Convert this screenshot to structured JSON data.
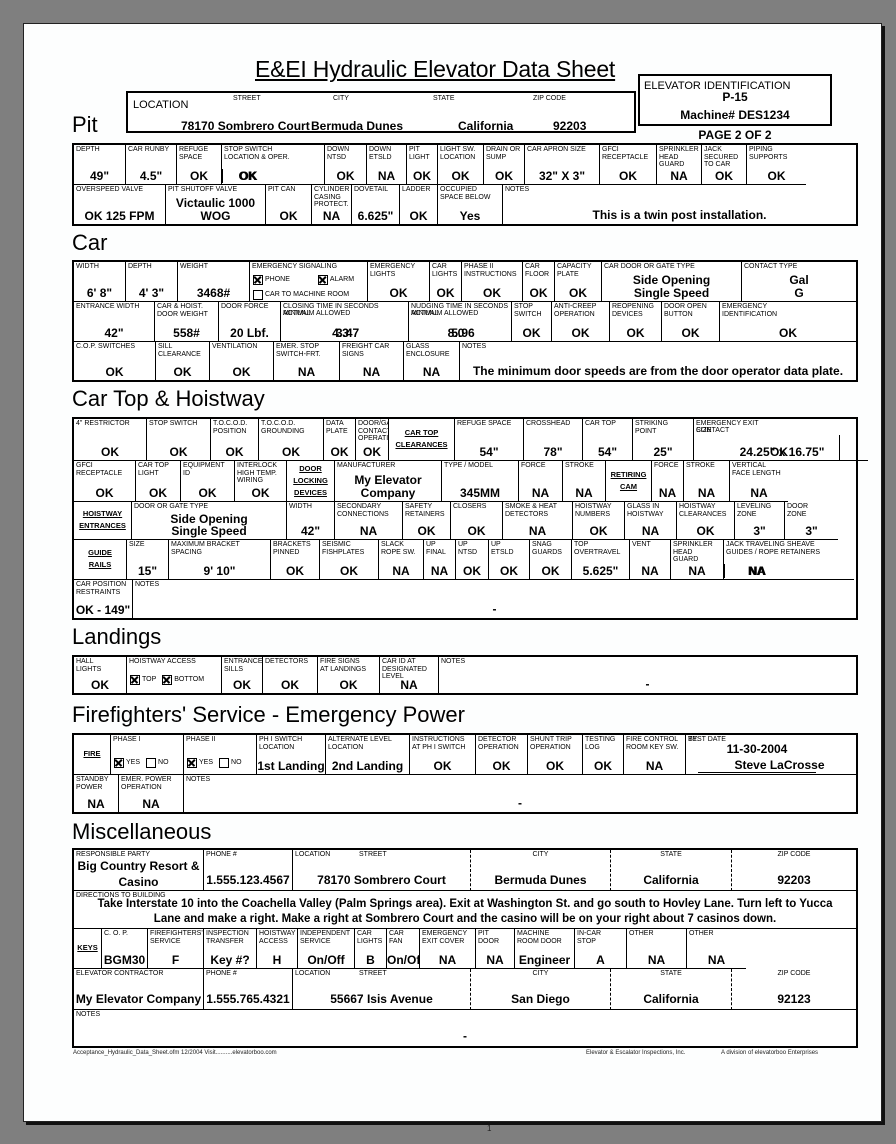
{
  "document": {
    "title": "E&EI Hydraulic Elevator Data Sheet",
    "page_label": "PAGE 2 OF 2",
    "page_number": "1"
  },
  "header": {
    "location_label": "LOCATION",
    "street_label": "STREET",
    "city_label": "CITY",
    "state_label": "STATE",
    "zip_label": "ZIP CODE",
    "street": "78170 Sombrero Court",
    "city": "Bermuda Dunes",
    "state": "California",
    "zip": "92203",
    "elev_id_label": "ELEVATOR IDENTIFICATION",
    "elev_id": "P-15",
    "machine": "Machine# DES1234"
  },
  "sections": {
    "pit": "Pit",
    "car": "Car",
    "cartop": "Car Top & Hoistway",
    "landings": "Landings",
    "fire": "Firefighters' Service - Emergency Power",
    "misc": "Miscellaneous"
  },
  "pit": {
    "row1": [
      {
        "label": "DEPTH",
        "value": "49\""
      },
      {
        "label": "CAR RUNBY",
        "value": "4.5\""
      },
      {
        "label": "REFUGE\nSPACE",
        "value": "OK"
      },
      {
        "label": "STOP SWITCH\nLOCATION & OPER.",
        "value": "OK",
        "value2": "OK"
      },
      {
        "label": "DOWN\nNTSD",
        "value": "OK"
      },
      {
        "label": "DOWN\nETSLD",
        "value": "NA"
      },
      {
        "label": "PIT\nLIGHT",
        "value": "OK"
      },
      {
        "label": "LIGHT SW.\nLOCATION",
        "value": "OK"
      },
      {
        "label": "DRAIN OR\nSUMP",
        "value": "OK"
      },
      {
        "label": "CAR APRON SIZE",
        "value": "32\" X 3\""
      },
      {
        "label": "GFCI\nRECEPTACLE",
        "value": "OK"
      },
      {
        "label": "SPRINKLER\nHEAD\nGUARD",
        "value": "NA"
      },
      {
        "label": "JACK\nSECURED\nTO CAR",
        "value": "OK"
      },
      {
        "label": "PIPING\nSUPPORTS",
        "value": "OK"
      }
    ],
    "row2": [
      {
        "label": "OVERSPEED VALVE",
        "value": "OK 125 FPM"
      },
      {
        "label": "PIT SHUTOFF VALVE",
        "value": "Victaulic 1000",
        "value2": "WOG"
      },
      {
        "label": "PIT CAN",
        "value": "OK"
      },
      {
        "label": "CYLINDER\nCASING\nPROTECT.",
        "value": "NA"
      },
      {
        "label": "DOVETAIL",
        "value": "6.625\""
      },
      {
        "label": "LADDER",
        "value": "OK"
      },
      {
        "label": "OCCUPIED\nSPACE BELOW",
        "value": "Yes"
      },
      {
        "label": "NOTES",
        "value": "This is a twin post installation."
      }
    ]
  },
  "car": {
    "row1": [
      {
        "label": "WIDTH",
        "value": "6' 8\""
      },
      {
        "label": "DEPTH",
        "value": "4' 3\""
      },
      {
        "label": "WEIGHT",
        "value": "3468#"
      },
      {
        "label": "EMERGENCY SIGNALING",
        "phone": "PHONE",
        "alarm": "ALARM",
        "car_to_machine": "CAR TO MACHINE ROOM"
      },
      {
        "label": "EMERGENCY\nLIGHTS",
        "value": "OK"
      },
      {
        "label": "CAR\nLIGHTS",
        "value": "OK"
      },
      {
        "label": "PHASE II\nINSTRUCTIONS",
        "value": "OK"
      },
      {
        "label": "CAR\nFLOOR",
        "value": "OK"
      },
      {
        "label": "CAPACITY\nPLATE",
        "value": "OK"
      },
      {
        "label": "CAR DOOR OR GATE TYPE",
        "value": "Side Opening",
        "value2": "Single Speed"
      },
      {
        "label": "CONTACT TYPE",
        "value": "Gal",
        "value2": "G"
      }
    ],
    "signaling": {
      "phone": true,
      "alarm": true,
      "car_to_machine": false
    },
    "row2": [
      {
        "label": "ENTRANCE WIDTH",
        "value": "42\""
      },
      {
        "label": "CAR & HOIST.\nDOOR WEIGHT",
        "value": "558#"
      },
      {
        "label": "DOOR FORCE",
        "value": "20 Lbf."
      },
      {
        "label": "CLOSING TIME IN SECONDS",
        "sub1": "MINIMUM ALLOWED",
        "sub2": "ACTUAL",
        "value": "3.47",
        "value2": "4.3"
      },
      {
        "label": "NUDGING TIME IN SECONDS",
        "sub1": "MINIMUM ALLOWED",
        "sub2": "ACTUAL",
        "value": "5.96",
        "value2": "8.0"
      },
      {
        "label": "STOP\nSWITCH",
        "value": "OK"
      },
      {
        "label": "ANTI-CREEP\nOPERATION",
        "value": "OK"
      },
      {
        "label": "REOPENING\nDEVICES",
        "value": "OK"
      },
      {
        "label": "DOOR OPEN\nBUTTON",
        "value": "OK"
      },
      {
        "label": "EMERGENCY\nIDENTIFICATION",
        "value": "OK"
      }
    ],
    "row3": [
      {
        "label": "C.O.P. SWITCHES",
        "value": "OK"
      },
      {
        "label": "SILL\nCLEARANCE",
        "value": "OK"
      },
      {
        "label": "VENTILATION",
        "value": "OK"
      },
      {
        "label": "EMER. STOP\nSWITCH-FRT.",
        "value": "NA"
      },
      {
        "label": "FREIGHT CAR\nSIGNS",
        "value": "NA"
      },
      {
        "label": "GLASS\nENCLOSURE",
        "value": "NA"
      },
      {
        "label": "NOTES",
        "value": "The minimum door speeds are from the door operator data plate."
      }
    ]
  },
  "cartop": {
    "row1": [
      {
        "label": "4\" RESTRICTOR",
        "value": "OK"
      },
      {
        "label": "STOP SWITCH",
        "value": "OK"
      },
      {
        "label": "T.O.C.O.D.\nPOSITION",
        "value": "OK"
      },
      {
        "label": "T.O.C.O.D.\nGROUNDING",
        "value": "OK"
      },
      {
        "label": "DATA\nPLATE",
        "value": "OK"
      },
      {
        "label": "DOOR/GATE\nCONTACT\nOPERATION",
        "value": "OK"
      },
      {
        "heading": "CAR TOP",
        "heading2": "CLEARANCES"
      },
      {
        "label": "REFUGE SPACE",
        "value": "54\""
      },
      {
        "label": "CROSSHEAD",
        "value": "78\""
      },
      {
        "label": "CAR TOP",
        "value": "54\""
      },
      {
        "label": "STRIKING\nPOINT",
        "value": "25\""
      },
      {
        "label": "EMERGENCY EXIT",
        "sub1": "SIZE",
        "sub2": "CONTACT",
        "value": "24.25\" x 16.75\"",
        "value2": "OK"
      }
    ],
    "row2": [
      {
        "label": "GFCI\nRECEPTACLE",
        "value": "OK"
      },
      {
        "label": "CAR TOP\nLIGHT",
        "value": "OK"
      },
      {
        "label": "EQUIPMENT\nID",
        "value": "OK"
      },
      {
        "label": "INTERLOCK\nHIGH TEMP.\nWIRING",
        "value": "OK"
      },
      {
        "heading": "DOOR",
        "heading2": "LOCKING",
        "heading3": "DEVICES"
      },
      {
        "label": "MANUFACTURER",
        "value": "My Elevator",
        "value2": "Company"
      },
      {
        "label": "TYPE / MODEL",
        "value": "345MM"
      },
      {
        "label": "FORCE",
        "value": "NA"
      },
      {
        "label": "STROKE",
        "value": "NA"
      },
      {
        "heading": "RETIRING",
        "heading2": "CAM"
      },
      {
        "label": "FORCE",
        "value": "NA"
      },
      {
        "label": "STROKE",
        "value": "NA"
      },
      {
        "label": "VERTICAL\nFACE LENGTH",
        "value": "NA"
      }
    ],
    "row3": [
      {
        "heading": "HOISTWAY",
        "heading2": "ENTRANCES"
      },
      {
        "label": "DOOR OR GATE TYPE",
        "value": "Side Opening",
        "value2": "Single Speed"
      },
      {
        "label": "WIDTH",
        "value": "42\""
      },
      {
        "label": "SECONDARY\nCONNECTIONS",
        "value": "NA"
      },
      {
        "label": "SAFETY\nRETAINERS",
        "value": "OK"
      },
      {
        "label": "CLOSERS",
        "value": "OK"
      },
      {
        "label": "SMOKE & HEAT\nDETECTORS",
        "value": "NA"
      },
      {
        "label": "HOISTWAY\nNUMBERS",
        "value": "OK"
      },
      {
        "label": "GLASS IN\nHOISTWAY",
        "value": "NA"
      },
      {
        "label": "HOISTWAY\nCLEARANCES",
        "value": "OK"
      },
      {
        "label": "LEVELING\nZONE",
        "value": "3\""
      },
      {
        "label": "DOOR\nZONE",
        "value": "3\""
      }
    ],
    "row4": [
      {
        "heading": "GUIDE",
        "heading2": "RAILS"
      },
      {
        "label": "SIZE",
        "value": "15\""
      },
      {
        "label": "MAXIMUM BRACKET\nSPACING",
        "value": "9' 10\""
      },
      {
        "label": "BRACKETS\nPINNED",
        "value": "OK"
      },
      {
        "label": "SEISMIC\nFISHPLATES",
        "value": "OK"
      },
      {
        "label": "SLACK\nROPE SW.",
        "value": "NA"
      },
      {
        "label": "UP\nFINAL",
        "value": "NA"
      },
      {
        "label": "UP\nNTSD",
        "value": "OK"
      },
      {
        "label": "UP\nETSLD",
        "value": "OK"
      },
      {
        "label": "SNAG\nGUARDS",
        "value": "OK"
      },
      {
        "label": "TOP\nOVERTRAVEL",
        "value": "5.625\""
      },
      {
        "label": "VENT",
        "value": "NA"
      },
      {
        "label": "SPRINKLER\nHEAD\nGUARD",
        "value": "NA"
      },
      {
        "label": "JACK TRAVELING SHEAVE\nGUIDES / ROPE RETAINERS",
        "value": "NA",
        "value2": "NA"
      }
    ],
    "row5": [
      {
        "label": "CAR POSITION\nRESTRAINTS",
        "value": "OK - 149\""
      },
      {
        "label": "NOTES",
        "value": "-"
      }
    ]
  },
  "landings": {
    "row1": [
      {
        "label": "HALL\nLIGHTS",
        "value": "OK"
      },
      {
        "label": "HOISTWAY ACCESS",
        "top": "TOP",
        "bottom": "BOTTOM"
      },
      {
        "label": "ENTRANCE\nSILLS",
        "value": "OK"
      },
      {
        "label": "DETECTORS",
        "value": "OK"
      },
      {
        "label": "FIRE SIGNS\nAT LANDINGS",
        "value": "OK"
      },
      {
        "label": "CAR ID AT\nDESIGNATED\nLEVEL",
        "value": "NA"
      },
      {
        "label": "NOTES",
        "value": "-"
      }
    ],
    "access": {
      "top": true,
      "bottom": true
    }
  },
  "fire": {
    "row1": [
      {
        "heading": "FIRE"
      },
      {
        "label": "PHASE I",
        "yes": "YES",
        "no": "NO"
      },
      {
        "label": "PHASE II",
        "yes": "YES",
        "no": "NO"
      },
      {
        "label": "PH I SWITCH\nLOCATION",
        "value": "1st Landing"
      },
      {
        "label": "ALTERNATE LEVEL\nLOCATION",
        "value": "2nd Landing"
      },
      {
        "label": "INSTRUCTIONS\nAT PH I SWITCH",
        "value": "OK"
      },
      {
        "label": "DETECTOR\nOPERATION",
        "value": "OK"
      },
      {
        "label": "SHUNT TRIP\nOPERATION",
        "value": "OK"
      },
      {
        "label": "TESTING\nLOG",
        "value": "OK"
      },
      {
        "label": "FIRE CONTROL\nROOM KEY SW.",
        "value": "NA"
      },
      {
        "label": "TEST DATE",
        "value": "11-30-2004",
        "by_label": "BY:",
        "by": "Steve LaCrosse"
      }
    ],
    "phase1": {
      "yes": true,
      "no": false
    },
    "phase2": {
      "yes": true,
      "no": false
    },
    "row2": [
      {
        "label": "STANDBY\nPOWER",
        "value": "NA"
      },
      {
        "label": "EMER. POWER\nOPERATION",
        "value": "NA"
      },
      {
        "label": "NOTES",
        "value": "-"
      }
    ]
  },
  "misc": {
    "party": {
      "label": "RESPONSIBLE PARTY",
      "value": "Big Country Resort &",
      "value2": "Casino",
      "phone_label": "PHONE #",
      "phone": "1.555.123.4567",
      "location_label": "LOCATION",
      "street_label": "STREET",
      "street": "78170 Sombrero Court",
      "city_label": "CITY",
      "city": "Bermuda Dunes",
      "state_label": "STATE",
      "state": "California",
      "zip_label": "ZIP CODE",
      "zip": "92203"
    },
    "directions": {
      "label": "DIRECTIONS TO BUILDING",
      "line1": "Take Interstate 10 into the Coachella Valley (Palm Springs area). Exit at Washington St. and go south to Hovley Lane. Turn left to Yucca",
      "line2": "Lane and make a right. Make a right at Sombrero Court and the casino will be on your right about 7 casinos down."
    },
    "keys": [
      {
        "heading": "KEYS"
      },
      {
        "label": "C. O. P.",
        "value": "BGM30"
      },
      {
        "label": "FIREFIGHTERS'\nSERVICE",
        "value": "F"
      },
      {
        "label": "INSPECTION\nTRANSFER",
        "value": "Key #?"
      },
      {
        "label": "HOISTWAY\nACCESS",
        "value": "H"
      },
      {
        "label": "INDEPENDENT\nSERVICE",
        "value": "On/Off"
      },
      {
        "label": "CAR\nLIGHTS",
        "value": "B"
      },
      {
        "label": "CAR\nFAN",
        "value": "On/Off"
      },
      {
        "label": "EMERGENCY\nEXIT COVER",
        "value": "NA"
      },
      {
        "label": "PIT\nDOOR",
        "value": "NA"
      },
      {
        "label": "MACHINE\nROOM DOOR",
        "value": "Engineer"
      },
      {
        "label": "IN-CAR\nSTOP",
        "value": "A"
      },
      {
        "label": "OTHER",
        "value": "NA"
      },
      {
        "label": "OTHER",
        "value": "NA"
      }
    ],
    "contractor": {
      "label": "ELEVATOR CONTRACTOR",
      "value": "My Elevator Company",
      "phone_label": "PHONE #",
      "phone": "1.555.765.4321",
      "location_label": "LOCATION",
      "street_label": "STREET",
      "street": "55667 Isis Avenue",
      "city_label": "CITY",
      "city": "San Diego",
      "state_label": "STATE",
      "state": "California",
      "zip_label": "ZIP CODE",
      "zip": "92123"
    },
    "notes": {
      "label": "NOTES",
      "value": "-"
    }
  },
  "footer": {
    "left": "Acceptance_Hydraulic_Data_Sheet.ofm      12/2004   Visit..........elevatorboo.com",
    "center": "Elevator & Escalator Inspections, Inc.",
    "right": "A division of elevatorboo Enterprises"
  }
}
